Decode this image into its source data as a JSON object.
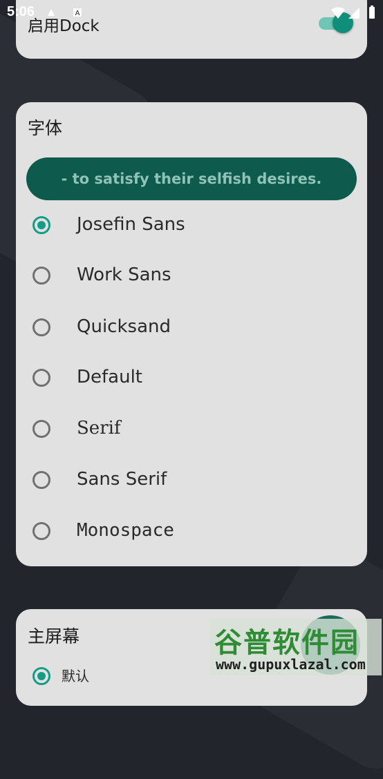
{
  "status_bar": {
    "time": "5:06"
  },
  "dock_card": {
    "label": "启用Dock",
    "enabled": true,
    "accent": "#0f8f7a"
  },
  "font_card": {
    "title": "字体",
    "preview_text": "- to satisfy their selfish desires.",
    "options": [
      {
        "label": "Josefin Sans",
        "selected": true
      },
      {
        "label": "Work Sans",
        "selected": false
      },
      {
        "label": "Quicksand",
        "selected": false
      },
      {
        "label": "Default",
        "selected": false
      },
      {
        "label": "Serif",
        "selected": false
      },
      {
        "label": "Sans Serif",
        "selected": false
      },
      {
        "label": "Monospace",
        "selected": false
      }
    ]
  },
  "home_card": {
    "title": "主屏幕",
    "options": [
      {
        "label": "默认",
        "selected": true
      }
    ]
  },
  "watermark": {
    "title": "谷普软件园",
    "url": "www.gupuxlazal.com"
  }
}
